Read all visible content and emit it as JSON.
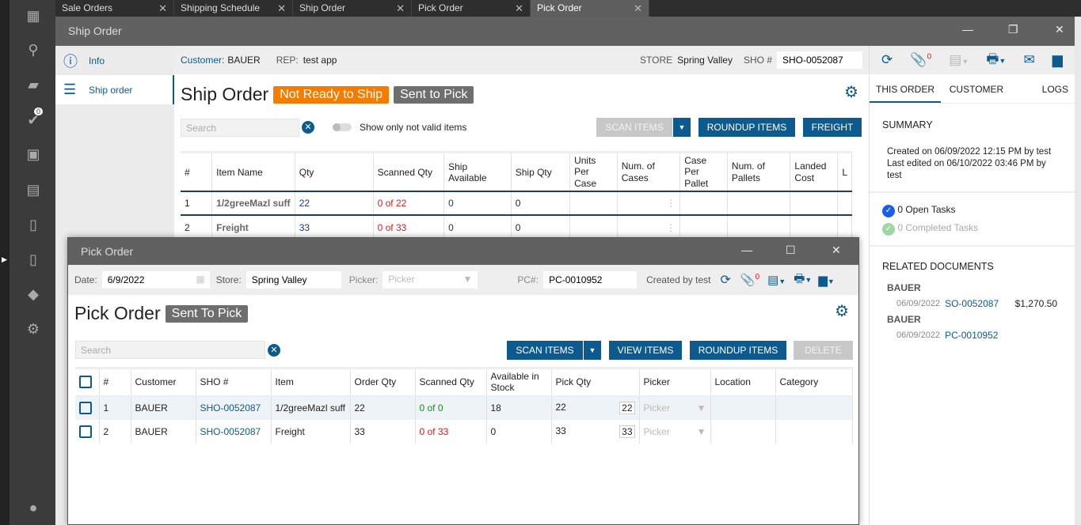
{
  "tabs": [
    {
      "label": "Sale Orders"
    },
    {
      "label": "Shipping Schedule"
    },
    {
      "label": "Ship Order"
    },
    {
      "label": "Pick Order"
    },
    {
      "label": "Pick Order",
      "active": true
    }
  ],
  "rail": {
    "badge": "0"
  },
  "ship_window": {
    "title": "Ship Order",
    "nav": [
      {
        "label": "Info"
      },
      {
        "label": "Ship order"
      }
    ],
    "info": {
      "customer_label": "Customer:",
      "customer": "BAUER",
      "rep_label": "REP:",
      "rep": "test app",
      "store_label": "STORE",
      "store": "Spring Valley",
      "sho_label": "SHO #",
      "sho": "SHO-0052087"
    },
    "heading": "Ship Order",
    "status1": "Not Ready to Ship",
    "status2": "Sent to Pick",
    "search_placeholder": "Search",
    "toggle_label": "Show only not valid items",
    "buttons": {
      "scan": "SCAN ITEMS",
      "roundup": "ROUNDUP ITEMS",
      "freight": "FREIGHT"
    },
    "columns": [
      "#",
      "Item Name",
      "Qty",
      "Scanned Qty",
      "Ship Available",
      "Ship Qty",
      "Units Per Case",
      "Num. of Cases",
      "Case Per Pallet",
      "Num. of Pallets",
      "Landed Cost",
      "L"
    ],
    "rows": [
      [
        "1",
        "1/2greeMazl suff",
        "22",
        "0 of 22",
        "0",
        "0"
      ],
      [
        "2",
        "Freight",
        "33",
        "0 of 33",
        "0",
        "0"
      ]
    ],
    "attach_count": "0",
    "right_tabs": [
      "THIS ORDER",
      "CUSTOMER",
      "LOGS"
    ],
    "summary": {
      "title": "SUMMARY",
      "created": "Created on 06/09/2022 12:15 PM by test",
      "edited": "Last edited on 06/10/2022 03:46 PM by test",
      "open_tasks": "0 Open Tasks",
      "completed_tasks": "0 Completed Tasks"
    },
    "related": {
      "title": "RELATED DOCUMENTS",
      "docs": [
        {
          "customer": "BAUER",
          "date": "06/09/2022",
          "number": "SO-0052087",
          "amount": "$1,270.50"
        },
        {
          "customer": "BAUER",
          "date": "06/09/2022",
          "number": "PC-0010952",
          "amount": ""
        }
      ]
    }
  },
  "pick_window": {
    "title": "Pick Order",
    "date_label": "Date:",
    "date": "6/9/2022",
    "store_label": "Store:",
    "store": "Spring Valley",
    "picker_label": "Picker:",
    "picker_placeholder": "Picker",
    "pc_label": "PC#:",
    "pc": "PC-0010952",
    "created_by": "Created by test",
    "attach_count": "0",
    "heading": "Pick Order",
    "status": "Sent To Pick",
    "search_placeholder": "Search",
    "buttons": {
      "scan": "SCAN ITEMS",
      "view": "VIEW ITEMS",
      "roundup": "ROUNDUP ITEMS",
      "delete": "DELETE"
    },
    "columns": [
      "#",
      "Customer",
      "SHO #",
      "Item",
      "Order Qty",
      "Scanned Qty",
      "Available in Stock",
      "Pick Qty",
      "Picker",
      "Location",
      "Category"
    ],
    "rows": [
      [
        "1",
        "BAUER",
        "SHO-0052087",
        "1/2greeMazl suff",
        "22",
        "0 of 0",
        "18",
        "22",
        "22",
        "Picker"
      ],
      [
        "2",
        "BAUER",
        "SHO-0052087",
        "Freight",
        "33",
        "0 of 33",
        "0",
        "33",
        "33",
        "Picker"
      ]
    ]
  },
  "colors": {
    "accent": "#0d5a8f",
    "orange": "#f57c00",
    "gray_badge": "#6e6e6e"
  }
}
